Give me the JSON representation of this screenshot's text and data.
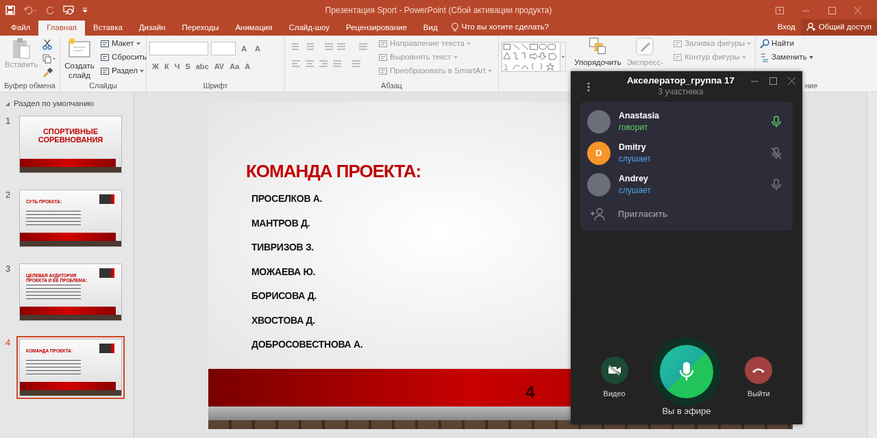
{
  "window": {
    "title": "Презентация Sport - PowerPoint (Сбой активации продукта)"
  },
  "account": {
    "sign_in": "Вход",
    "share": "Общий доступ"
  },
  "tabs": [
    {
      "label": "Файл",
      "selected": false
    },
    {
      "label": "Главная",
      "selected": true
    },
    {
      "label": "Вставка",
      "selected": false
    },
    {
      "label": "Дизайн",
      "selected": false
    },
    {
      "label": "Переходы",
      "selected": false
    },
    {
      "label": "Анимация",
      "selected": false
    },
    {
      "label": "Слайд-шоу",
      "selected": false
    },
    {
      "label": "Рецензирование",
      "selected": false
    },
    {
      "label": "Вид",
      "selected": false
    }
  ],
  "tell_me": {
    "placeholder": "Что вы хотите сделать?"
  },
  "ribbon": [
    {
      "kind": "clipboard",
      "label": "Буфер обмена",
      "paste": {
        "label": "Вставить",
        "disabled": true
      }
    },
    {
      "kind": "slides",
      "label": "Слайды",
      "new_slide": "Создать слайд",
      "commands": [
        {
          "label": "Макет",
          "disabled": false
        },
        {
          "label": "Сбросить",
          "disabled": false
        },
        {
          "label": "Раздел",
          "disabled": false
        }
      ]
    },
    {
      "kind": "font",
      "label": "Шрифт",
      "size_buttons": [
        "A",
        "A"
      ],
      "format_buttons": [
        "Ж",
        "К",
        "Ч",
        "S",
        "abc",
        "AV",
        "Aa",
        "A"
      ]
    },
    {
      "kind": "paragraph",
      "label": "Абзац",
      "commands": [
        {
          "label": "Направление текста",
          "disabled": true
        },
        {
          "label": "Выровнять текст",
          "disabled": true
        },
        {
          "label": "Преобразовать в SmartArt",
          "disabled": true
        }
      ]
    },
    {
      "kind": "drawing",
      "commands": [
        {
          "label": "Упорядочить",
          "disabled": false
        },
        {
          "label": "Экспресс-",
          "disabled": true
        }
      ],
      "shape_commands": [
        {
          "label": "Заливка фигуры",
          "disabled": true
        },
        {
          "label": "Контур фигуры",
          "disabled": true
        }
      ]
    },
    {
      "kind": "editing",
      "label": "ние",
      "commands": [
        {
          "label": "Найти",
          "disabled": false
        },
        {
          "label": "Заменить",
          "disabled": false
        }
      ]
    }
  ],
  "slides_panel": {
    "section": "Раздел по умолчанию",
    "slides": [
      {
        "number": "1",
        "selected": false,
        "kind": "title",
        "title": "СПОРТИВНЫЕ СОРЕВНОВАНИЯ"
      },
      {
        "number": "2",
        "selected": false,
        "kind": "content",
        "title": "СУТЬ ПРОЕКТА:"
      },
      {
        "number": "3",
        "selected": false,
        "kind": "content",
        "title": "ЦЕЛЕВАЯ АУДИТОРИЯ ПРОЕКТА И ЕЕ ПРОБЛЕМА:"
      },
      {
        "number": "4",
        "selected": true,
        "kind": "content",
        "title": "КОМАНДА ПРОЕКТА:"
      }
    ]
  },
  "slide": {
    "title": "КОМАНДА ПРОЕКТА:",
    "names": [
      "ПРОСЕЛКОВ А.",
      "МАНТРОВ Д.",
      "ТИВРИЗОВ З.",
      "МОЖАЕВА Ю.",
      "БОРИСОВА Д.",
      "ХВОСТОВА Д.",
      "ДОБРОСОВЕСТНОВА А."
    ],
    "number": "4"
  },
  "call": {
    "title": "Акселератор_группа 17",
    "subtitle": "3 участника",
    "participants": [
      {
        "name": "Anastasia",
        "status": "говорит",
        "kind": "photo",
        "speaking": true,
        "muted": false
      },
      {
        "name": "Dmitry",
        "status": "слушает",
        "kind": "letter",
        "letter": "D",
        "color": "#f7952a",
        "speaking": false,
        "muted": true
      },
      {
        "name": "Andrey",
        "status": "слушает",
        "kind": "photo",
        "speaking": false,
        "muted": false
      }
    ],
    "invite": "Пригласить",
    "video": {
      "label": "Видео",
      "on": false
    },
    "mic_label": "Вы в эфире",
    "leave": "Выйти"
  }
}
